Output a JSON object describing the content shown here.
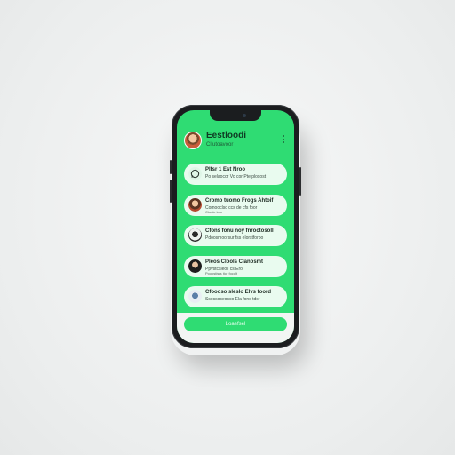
{
  "header": {
    "title": "Eestloodi",
    "subtitle": "Cliutoavoor"
  },
  "items": [
    {
      "icon": "whatsapp-icon",
      "line1": "Plfsr 1 Est Nroo",
      "line2": "Po selaocor Vo cor Pte ploxost",
      "line3": ""
    },
    {
      "icon": "avatar-icon",
      "line1": "Cromo tuomo Frogs Ahtoif",
      "line2": "Comooclsc ccs de cfs foor",
      "line3": "Ctoolc toor"
    },
    {
      "icon": "avatar-icon",
      "line1": "Cfons fonu noy fnroctosoll",
      "line2": "Pdoosmoorsur fss elorstforoo",
      "line3": ""
    },
    {
      "icon": "avatar-icon",
      "line1": "Pleos Clools Clanosmt",
      "line2": "Ppvstcsleoll cs Ero",
      "line3": "Pooostisrs itor focolt"
    },
    {
      "icon": "avatar-icon",
      "line1": "Cfoooso sleslo Elvs foord",
      "line2": "Ssocsoceosco Ela fons tdcr",
      "line3": ""
    }
  ],
  "footer": {
    "cta_label": "Loaefsel"
  }
}
